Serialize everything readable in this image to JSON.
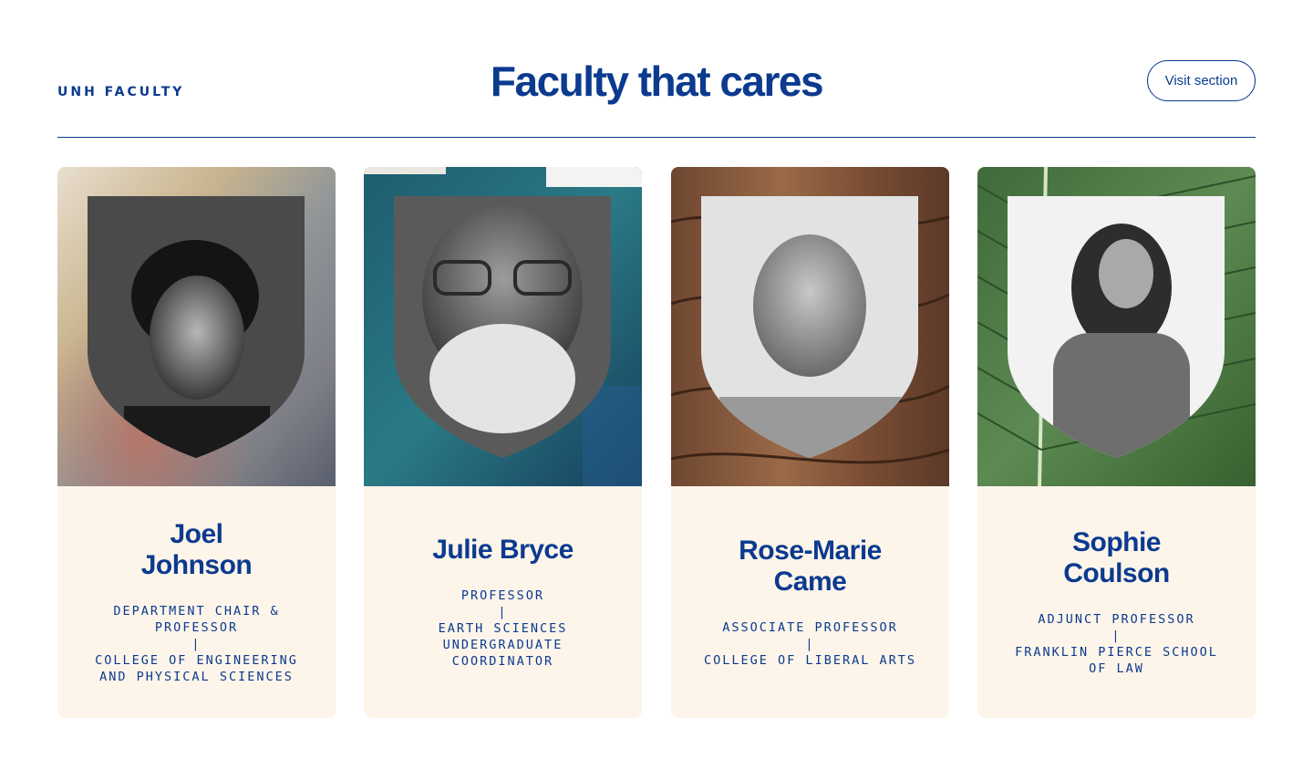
{
  "header": {
    "eyebrow": "UNH FACULTY",
    "title": "Faculty that cares",
    "visit_label": "Visit section"
  },
  "faculty": [
    {
      "name_line1": "Joel",
      "name_line2": "Johnson",
      "role_lines": [
        "DEPARTMENT CHAIR &",
        "PROFESSOR",
        "|",
        "COLLEGE OF ENGINEERING",
        "AND PHYSICAL SCIENCES"
      ],
      "background": "frosted-glass"
    },
    {
      "name_line1": "Julie Bryce",
      "name_line2": "",
      "role_lines": [
        "PROFESSOR",
        "|",
        "EARTH SCIENCES",
        "UNDERGRADUATE",
        "COORDINATOR"
      ],
      "background": "teal-paint"
    },
    {
      "name_line1": "Rose-Marie",
      "name_line2": "Came",
      "role_lines": [
        "ASSOCIATE PROFESSOR",
        "|",
        "COLLEGE OF LIBERAL ARTS"
      ],
      "background": "wood-grain"
    },
    {
      "name_line1": "Sophie",
      "name_line2": "Coulson",
      "role_lines": [
        "ADJUNCT PROFESSOR",
        "|",
        "FRANKLIN PIERCE SCHOOL",
        "OF LAW"
      ],
      "background": "green-leaf"
    }
  ],
  "colors": {
    "brand_blue": "#0b3a8f",
    "card_cream": "#fdf5ea"
  }
}
